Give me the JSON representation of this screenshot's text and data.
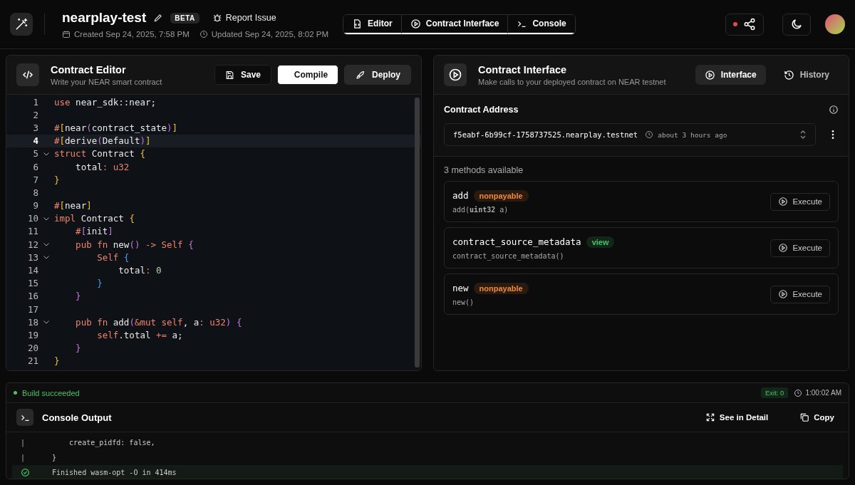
{
  "header": {
    "project": "nearplay-test",
    "badge": "BETA",
    "report": "Report Issue",
    "created": "Created Sep 24, 2025, 7:58 PM",
    "updated": "Updated Sep 24, 2025, 8:02 PM",
    "tabs": [
      {
        "label": "Editor",
        "selected": true
      },
      {
        "label": "Contract Interface",
        "selected": true
      },
      {
        "label": "Console",
        "selected": true
      }
    ],
    "share_status": {
      "color": "#e5484d"
    }
  },
  "editor": {
    "title": "Contract Editor",
    "subtitle": "Write your NEAR smart contract",
    "buttons": [
      {
        "label": "Save",
        "kind": "dark"
      },
      {
        "label": "Compile",
        "kind": "primary"
      },
      {
        "label": "Deploy",
        "kind": "secondary"
      }
    ],
    "lines": [
      {
        "number": "1",
        "fold": false,
        "selected": false,
        "tokens": [
          {
            "kind": "kw",
            "t": "use"
          },
          {
            "kind": "t",
            "t": " near_sdk::near;"
          }
        ]
      },
      {
        "number": "2",
        "fold": false,
        "selected": false
      },
      {
        "number": "3",
        "fold": false,
        "selected": false,
        "tokens": [
          {
            "kind": "kw",
            "t": "#"
          },
          {
            "kind": "y",
            "t": "["
          },
          {
            "kind": "t",
            "t": "near"
          },
          {
            "kind": "p",
            "t": "("
          },
          {
            "kind": "t",
            "t": "contract_state"
          },
          {
            "kind": "p",
            "t": ")"
          },
          {
            "kind": "y",
            "t": "]"
          }
        ]
      },
      {
        "number": "4",
        "fold": false,
        "selected": true,
        "tokens": [
          {
            "kind": "kw",
            "t": "#"
          },
          {
            "kind": "y",
            "t": "["
          },
          {
            "kind": "t",
            "t": "derive"
          },
          {
            "kind": "p",
            "t": "("
          },
          {
            "kind": "t",
            "t": "Default"
          },
          {
            "kind": "p",
            "t": ")"
          },
          {
            "kind": "y",
            "t": "]"
          }
        ]
      },
      {
        "number": "5",
        "fold": true,
        "selected": false,
        "tokens": [
          {
            "kind": "kw",
            "t": "struct"
          },
          {
            "kind": "t",
            "t": " Contract "
          },
          {
            "kind": "y",
            "t": "{"
          }
        ]
      },
      {
        "number": "6",
        "fold": false,
        "selected": false,
        "tokens": [
          {
            "kind": "t",
            "t": "    total"
          },
          {
            "kind": "kw",
            "t": ": u32"
          }
        ]
      },
      {
        "number": "7",
        "fold": false,
        "selected": false,
        "tokens": [
          {
            "kind": "y",
            "t": "}"
          }
        ]
      },
      {
        "number": "8",
        "fold": false,
        "selected": false
      },
      {
        "number": "9",
        "fold": false,
        "selected": false,
        "tokens": [
          {
            "kind": "kw",
            "t": "#"
          },
          {
            "kind": "y",
            "t": "["
          },
          {
            "kind": "t",
            "t": "near"
          },
          {
            "kind": "y",
            "t": "]"
          }
        ]
      },
      {
        "number": "10",
        "fold": true,
        "selected": false,
        "tokens": [
          {
            "kind": "kw",
            "t": "impl"
          },
          {
            "kind": "t",
            "t": " Contract "
          },
          {
            "kind": "y",
            "t": "{"
          }
        ]
      },
      {
        "number": "11",
        "fold": false,
        "selected": false,
        "tokens": [
          {
            "kind": "kw",
            "t": "    #"
          },
          {
            "kind": "p",
            "t": "["
          },
          {
            "kind": "t",
            "t": "init"
          },
          {
            "kind": "p",
            "t": "]"
          }
        ]
      },
      {
        "number": "12",
        "fold": true,
        "selected": false,
        "tokens": [
          {
            "kind": "kw",
            "t": "    pub fn"
          },
          {
            "kind": "t",
            "t": " new"
          },
          {
            "kind": "p",
            "t": "()"
          },
          {
            "kind": "kw",
            "t": " -> Self "
          },
          {
            "kind": "p",
            "t": "{"
          }
        ]
      },
      {
        "number": "13",
        "fold": true,
        "selected": false,
        "tokens": [
          {
            "kind": "kw",
            "t": "        Self "
          },
          {
            "kind": "b",
            "t": "{"
          }
        ]
      },
      {
        "number": "14",
        "fold": false,
        "selected": false,
        "tokens": [
          {
            "kind": "t",
            "t": "            total"
          },
          {
            "kind": "kw",
            "t": ": "
          },
          {
            "kind": "n",
            "t": "0"
          }
        ]
      },
      {
        "number": "15",
        "fold": false,
        "selected": false,
        "tokens": [
          {
            "kind": "b",
            "t": "        }"
          }
        ]
      },
      {
        "number": "16",
        "fold": false,
        "selected": false,
        "tokens": [
          {
            "kind": "p",
            "t": "    }"
          }
        ]
      },
      {
        "number": "17",
        "fold": false,
        "selected": false
      },
      {
        "number": "18",
        "fold": true,
        "selected": false,
        "tokens": [
          {
            "kind": "kw",
            "t": "    pub fn"
          },
          {
            "kind": "t",
            "t": " add"
          },
          {
            "kind": "p",
            "t": "("
          },
          {
            "kind": "kw",
            "t": "&mut self"
          },
          {
            "kind": "t",
            "t": ", a"
          },
          {
            "kind": "kw",
            "t": ": u32"
          },
          {
            "kind": "p",
            "t": ") {"
          }
        ]
      },
      {
        "number": "19",
        "fold": false,
        "selected": false,
        "tokens": [
          {
            "kind": "kw",
            "t": "        self"
          },
          {
            "kind": "t",
            "t": ".total "
          },
          {
            "kind": "kw",
            "t": "+="
          },
          {
            "kind": "t",
            "t": " a;"
          }
        ]
      },
      {
        "number": "20",
        "fold": false,
        "selected": false,
        "tokens": [
          {
            "kind": "p",
            "t": "    }"
          }
        ]
      },
      {
        "number": "21",
        "fold": false,
        "selected": false,
        "tokens": [
          {
            "kind": "y",
            "t": "}"
          }
        ]
      }
    ]
  },
  "interface": {
    "title": "Contract Interface",
    "subtitle": "Make calls to your deployed contract on NEAR testnet",
    "tabs": [
      {
        "label": "Interface",
        "selected": true
      },
      {
        "label": "History",
        "selected": false
      }
    ],
    "address_label": "Contract Address",
    "address": "f5eabf-6b99cf-1758737525.nearplay.testnet",
    "address_time": "about 3 hours ago",
    "methods_count": "3 methods available",
    "methods": [
      {
        "name": "add",
        "badge": "nonpayable",
        "kind": "nonpayable",
        "signature": "add(**uint32** a)",
        "action": "Execute"
      },
      {
        "name": "contract_source_metadata",
        "badge": "view",
        "kind": "view",
        "signature": "contract_source_metadata()",
        "action": "Execute"
      },
      {
        "name": "new",
        "badge": "nonpayable",
        "kind": "nonpayable",
        "signature": "new()",
        "action": "Execute"
      }
    ]
  },
  "console": {
    "status": "Build succeeded",
    "exit": "Exit: 0",
    "time": "1:00:02 AM",
    "title": "Console Output",
    "actions": [
      "See in Detail",
      "Copy"
    ],
    "lines": [
      {
        "kind": "pipe",
        "mark": "|",
        "text": "    create_pidfd: false,"
      },
      {
        "kind": "pipe",
        "mark": "|",
        "text": "}"
      },
      {
        "kind": "success",
        "text": "Finished wasm-opt -O in 414ms"
      }
    ]
  }
}
